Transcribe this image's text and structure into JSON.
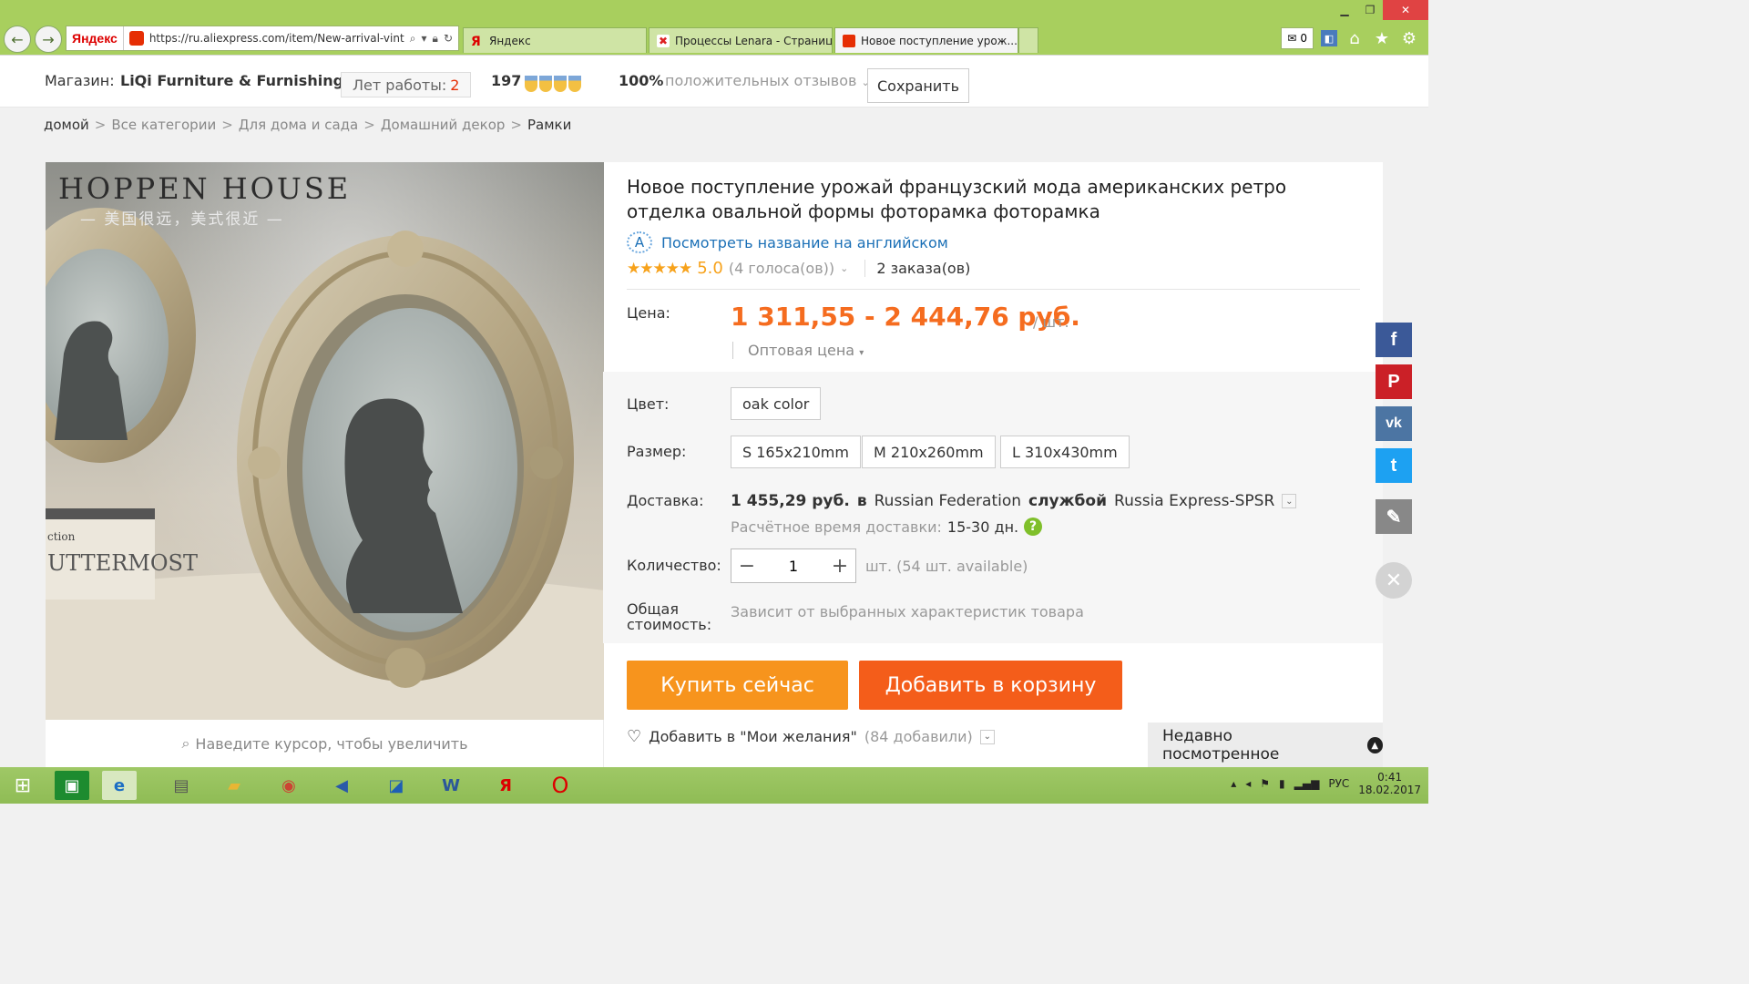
{
  "browser": {
    "address_badge": "Яндекс",
    "url": "https://ru.aliexpress.com/item/New-arrival-vinta",
    "tabs": [
      {
        "label": "Яндекс",
        "active": false
      },
      {
        "label": "Процессы Lenara - Страница ...",
        "active": false
      },
      {
        "label": "Новое поступление урож...",
        "active": true
      }
    ],
    "mail_count": "0",
    "accent": "#a8cf5e"
  },
  "store": {
    "label": "Магазин:",
    "name": "LiQi Furniture & Furnishings",
    "years_label": "Лет работы:",
    "years_value": "2",
    "score": "197",
    "positive_percent": "100%",
    "positive_label": "положительных отзывов",
    "save_label": "Сохранить"
  },
  "breadcrumb": [
    "домой",
    "Все категории",
    "Для дома и сада",
    "Домашний декор",
    "Рамки"
  ],
  "image": {
    "brand_text": "HOPPEN HOUSE",
    "brand_sub": "— 美国很远，美式很近 —",
    "book_text": "UTTERMOST",
    "book_small": "ction",
    "zoom_hint": "Наведите курсор, чтобы увеличить"
  },
  "product": {
    "title": "Новое поступление урожай французский мода американских ретро отделка овальной формы фоторамка фоторамка",
    "translate_label": "Посмотреть название на английском",
    "stars": "★★★★★",
    "rating": "5.0",
    "votes": "(4 голоса(ов))",
    "orders": "2 заказа(ов)",
    "price_label": "Цена:",
    "price": "1 311,55 - 2 444,76 руб.",
    "price_unit": "/ шт.",
    "wholesale": "Оптовая цена",
    "color_label": "Цвет:",
    "color_options": [
      "oak color"
    ],
    "size_label": "Размер:",
    "size_options": [
      "S 165x210mm",
      "M 210x260mm",
      "L 310x430mm"
    ],
    "delivery_label": "Доставка:",
    "delivery_price": "1 455,29 руб.",
    "delivery_in": "в",
    "delivery_country": "Russian Federation",
    "delivery_service_prefix": "службой",
    "delivery_service": "Russia Express-SPSR",
    "eta_label": "Расчётное время доставки:",
    "eta_value": "15-30 дн.",
    "qty_label": "Количество:",
    "qty_value": "1",
    "qty_note": "шт. (54 шт. available)",
    "total_label_1": "Общая",
    "total_label_2": "стоимость:",
    "total_note": "Зависит от выбранных характеристик товара",
    "buy_now": "Купить сейчас",
    "add_to_cart": "Добавить в корзину",
    "wish_label": "Добавить в \"Мои желания\"",
    "wish_count": "(84 добавили)",
    "price_color": "#f56c1f",
    "buy_now_color": "#f7941d",
    "cart_color": "#f45d1a"
  },
  "recently_viewed": "Недавно посмотренное",
  "social": [
    {
      "name": "facebook",
      "glyph": "f",
      "color": "#3b5998"
    },
    {
      "name": "pinterest",
      "glyph": "P",
      "color": "#cb2027"
    },
    {
      "name": "vk",
      "glyph": "vk",
      "color": "#4c75a3"
    },
    {
      "name": "twitter",
      "glyph": "t",
      "color": "#1da1f2"
    },
    {
      "name": "edit",
      "glyph": "✎",
      "color": "#888888"
    }
  ],
  "taskbar": {
    "lang": "РУС",
    "time": "0:41",
    "date": "18.02.2017"
  }
}
